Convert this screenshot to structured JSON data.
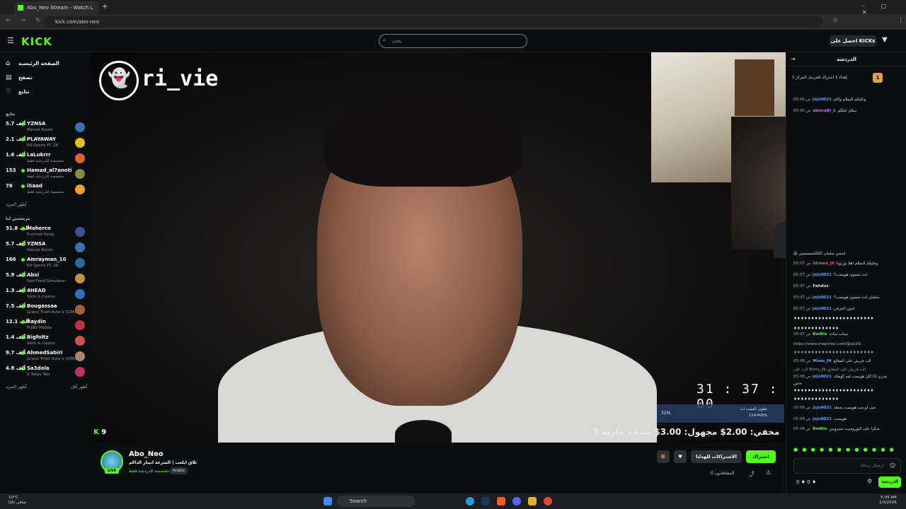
{
  "browser": {
    "tab_title": "Abo_Neo Stream - Watch L",
    "url": "kick.com/abo-neo"
  },
  "header": {
    "logo": "KICK",
    "search_placeholder": "بحث",
    "get_kicks_label": "احصل على KICKs"
  },
  "sidebar": {
    "nav": [
      {
        "label": "الصفحة الرئيسية",
        "icon": "home-icon"
      },
      {
        "label": "تصفح",
        "icon": "browse-icon"
      },
      {
        "label": "تتابع",
        "icon": "heart-icon"
      }
    ],
    "following_title": "تتابع",
    "following": [
      {
        "name": "YZNSA",
        "viewers": "5.7 ألف",
        "game": "Marvel Rivals",
        "color": "#3b6fb0"
      },
      {
        "name": "PLAYAWAY",
        "viewers": "2.1 ألف",
        "game": "EA Sports FC 26",
        "color": "#e0c020"
      },
      {
        "name": "LaLukrrr",
        "viewers": "1.6 ألف",
        "game": "مخصصة للدردشة فقط",
        "color": "#e06030"
      },
      {
        "name": "Hamad_al7anoti",
        "viewers": "153",
        "game": "مخصصة للدردشة فقط",
        "color": "#8a8a40"
      },
      {
        "name": "iSaad",
        "viewers": "76",
        "game": "مخصصة للدردشة فقط",
        "color": "#f0a030"
      }
    ],
    "following_more": "أظهر المزيد",
    "recommended_title": "مرشحين لنا",
    "recommended": [
      {
        "name": "Maherco",
        "viewers": "31.8 ألف",
        "game": "Pummel Party",
        "color": "#4050a0"
      },
      {
        "name": "YZNSA",
        "viewers": "5.7 ألف",
        "game": "Marvel Rivals",
        "color": "#3b6fb0"
      },
      {
        "name": "Amrayman_10",
        "viewers": "166",
        "game": "EA Sports FC 26",
        "color": "#2a6aa0"
      },
      {
        "name": "Absi",
        "viewers": "5.9 ألف",
        "game": "Fast Food Simulator",
        "color": "#c09040"
      },
      {
        "name": "4HEAD",
        "viewers": "1.3 ألف",
        "game": "Slots & Casino",
        "color": "#3070c0"
      },
      {
        "name": "Bougassaa",
        "viewers": "7.5 ألف",
        "game": "Grand Theft Auto V (GTA)",
        "color": "#a06040"
      },
      {
        "name": "Raydin",
        "viewers": "12.1 ألف",
        "game": "PUBG Mobile",
        "color": "#c03040"
      },
      {
        "name": "Bigfoltz",
        "viewers": "1.4 ألف",
        "game": "Slots & Casino",
        "color": "#d05050"
      },
      {
        "name": "AhmedSabiri",
        "viewers": "9.7 ألف",
        "game": "Grand Theft Auto V (GTA)",
        "color": "#b08070"
      },
      {
        "name": "Sa3dola",
        "viewers": "4.8 ألف",
        "game": "It Takes Two",
        "color": "#c03060"
      }
    ],
    "show_less": "أظهر أقل",
    "show_more": "أظهر المزيد"
  },
  "player": {
    "snap_handle": "ri_vie",
    "timer": "31 : 37 : 00",
    "goal_pct": "31%",
    "goal_line1": "تطوير السيت اب",
    "goal_line2": "124/400$",
    "donation_bar": "5 مخفي: 2.00$ مجهول: 3.00$ صدقة جارية",
    "overlay_viewers": "9"
  },
  "stream": {
    "username": "Abo_Neo",
    "title": "تلاق ايلعب | السرعة انيتار الداكم",
    "category": "مخصصة للدردشة فقط",
    "language": "Arabic",
    "live_label": "LIVE",
    "follow_label": "اشتراك",
    "subs_label": "الاشتراكات للهدايا",
    "viewers_label": "المشاهدون 0"
  },
  "chat": {
    "title": "الدردشة",
    "pinned_text": "إهداء 1 اشتراك للمرسل المركز 1",
    "pinned_badge": "1",
    "messages": [
      {
        "time": "05:06 ص",
        "user": "jojo0021",
        "color": "#5b9bff",
        "text": "وعليكم السلام ولكم"
      },
      {
        "time": "05:06 ص",
        "user": "abonaBr_x",
        "color": "#b070ff",
        "text": "سلام عليكم"
      },
      {
        "time": "",
        "user": "",
        "color": "#ddd",
        "text": "@ اسمي سلمان ككككسسسس"
      },
      {
        "time": "05:07 ص",
        "user": "Ahmed_JX",
        "color": "#ff5060",
        "text": "وعليكم السلام اهلا نورتونا"
      },
      {
        "time": "05:07 ص",
        "user": "jojo0021",
        "color": "#5b9bff",
        "text": "انت مسوي هويست؟"
      },
      {
        "time": "05:07 ص",
        "user": "Fahdux",
        "color": "#ddd",
        "text": ""
      },
      {
        "time": "05:07 ص",
        "user": "jojo0021",
        "color": "#5b9bff",
        "text": "سلمان انت مسوي هويست؟"
      },
      {
        "time": "05:07 ص",
        "user": "jojo0021",
        "color": "#5b9bff",
        "text": "اجين اعترفي"
      },
      {
        "time": "",
        "user": "",
        "color": "#ddd",
        "text": "♦♦♦♦♦♦♦♦♦♦♦♦♦♦♦♦♦♦♦♦♦♦♦"
      },
      {
        "time": "",
        "user": "",
        "color": "#ddd",
        "text": "♦♦♦♦♦♦♦♦♦♦♦♦♦"
      },
      {
        "time": "05:07 ص",
        "user": "BotRix",
        "color": "#53fc18",
        "text": "سناب شات"
      },
      {
        "time": "",
        "user": "",
        "color": "#8fb8ff",
        "text": "https://www.snapchat.com/@ao2lk"
      },
      {
        "time": "",
        "user": "",
        "color": "#999",
        "text": "♦♦♦♦♦♦♦♦♦♦♦♦♦♦♦♦♦♦♦♦♦♦♦"
      },
      {
        "time": "05:08 ص",
        "user": "Mona_JN",
        "color": "#5b9bff",
        "text": "الت فريش على المقاتع"
      },
      {
        "time": "",
        "user": "",
        "color": "#999",
        "text": "الرد على Mona_JN: الت فريش على المقاتع"
      },
      {
        "time": "05:08 ص",
        "user": "jojo0021",
        "color": "#5b9bff",
        "text": "مدري اذا كان هويست فيه كوملك"
      },
      {
        "time": "",
        "user": "",
        "color": "#ddd",
        "text": "خاص"
      },
      {
        "time": "",
        "user": "",
        "color": "#ddd",
        "text": "♦♦♦♦♦♦♦♦♦♦♦♦♦♦♦♦♦♦♦♦♦♦♦"
      },
      {
        "time": "",
        "user": "",
        "color": "#ddd",
        "text": "♦♦♦♦♦♦♦♦♦♦♦♦♦"
      },
      {
        "time": "05:08 ص",
        "user": "jojo0021",
        "color": "#5b9bff",
        "text": "حتى لو مب هويست يحطه"
      },
      {
        "time": "05:08 ص",
        "user": "jojo0021",
        "color": "#5b9bff",
        "text": "هويست"
      },
      {
        "time": "05:08 ص",
        "user": "BotRix",
        "color": "#53fc18",
        "text": "شكرا على اليوروسيت متبروبين"
      }
    ],
    "emote_row": "● ● ● ● ● ● ● ● ● ● ● ●",
    "input_placeholder": "إرسال رسالة",
    "send_label": "الدردشة",
    "counts": "0 ♦   0 ♦"
  },
  "taskbar": {
    "weather_temp": "10°C",
    "weather_desc": "صافي غالبًا",
    "search_label": "Search",
    "time": "5:09 AM",
    "date": "1/3/2026"
  },
  "colors": {
    "brand": "#53fc18",
    "background": "#0b0e0f"
  }
}
